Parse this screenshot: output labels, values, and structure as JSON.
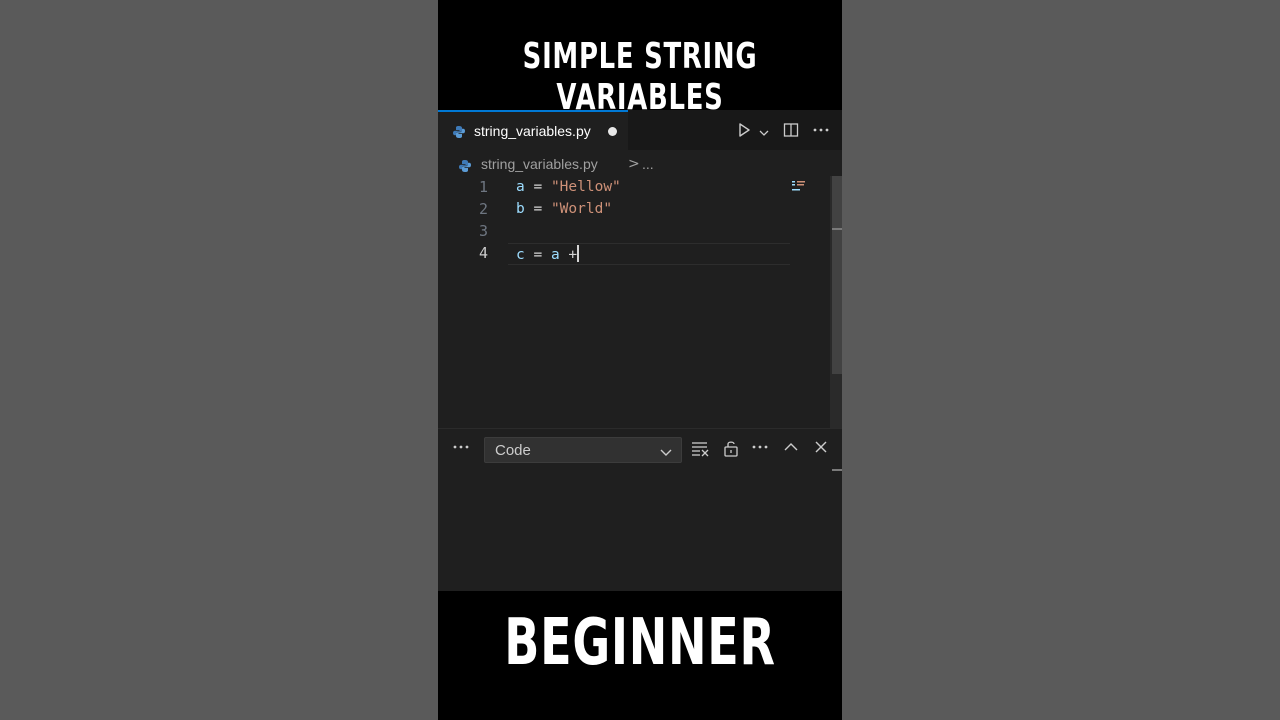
{
  "overlay": {
    "top_title": "SIMPLE STRING VARIABLES",
    "bottom_title": "BEGINNER"
  },
  "editor": {
    "tab": {
      "label": "string_variables.py",
      "dirty": true,
      "icon": "python-icon"
    },
    "toolbar": {
      "icons": [
        "run-icon",
        "chevron-down-icon",
        "split-editor-icon",
        "more-actions-icon"
      ]
    },
    "breadcrumb": {
      "file": "string_variables.py",
      "separator": ">",
      "more": "..."
    },
    "lines": [
      {
        "number": "1",
        "tokens": [
          {
            "t": "a",
            "k": "var"
          },
          {
            "t": " = ",
            "k": "op"
          },
          {
            "t": "\"Hellow\"",
            "k": "str"
          }
        ]
      },
      {
        "number": "2",
        "tokens": [
          {
            "t": "b",
            "k": "var"
          },
          {
            "t": " = ",
            "k": "op"
          },
          {
            "t": "\"World\"",
            "k": "str"
          }
        ]
      },
      {
        "number": "3",
        "tokens": []
      },
      {
        "number": "4",
        "tokens": [
          {
            "t": "c",
            "k": "var"
          },
          {
            "t": " = ",
            "k": "op"
          },
          {
            "t": "a",
            "k": "var"
          },
          {
            "t": " +",
            "k": "op"
          }
        ]
      }
    ],
    "active_line": "4",
    "accent_color": "#0078d4"
  },
  "panel": {
    "select_value": "Code",
    "icons": [
      "more-icon",
      "clear-output-icon",
      "lock-icon",
      "more-actions-icon",
      "chevron-up-icon",
      "close-icon"
    ]
  }
}
